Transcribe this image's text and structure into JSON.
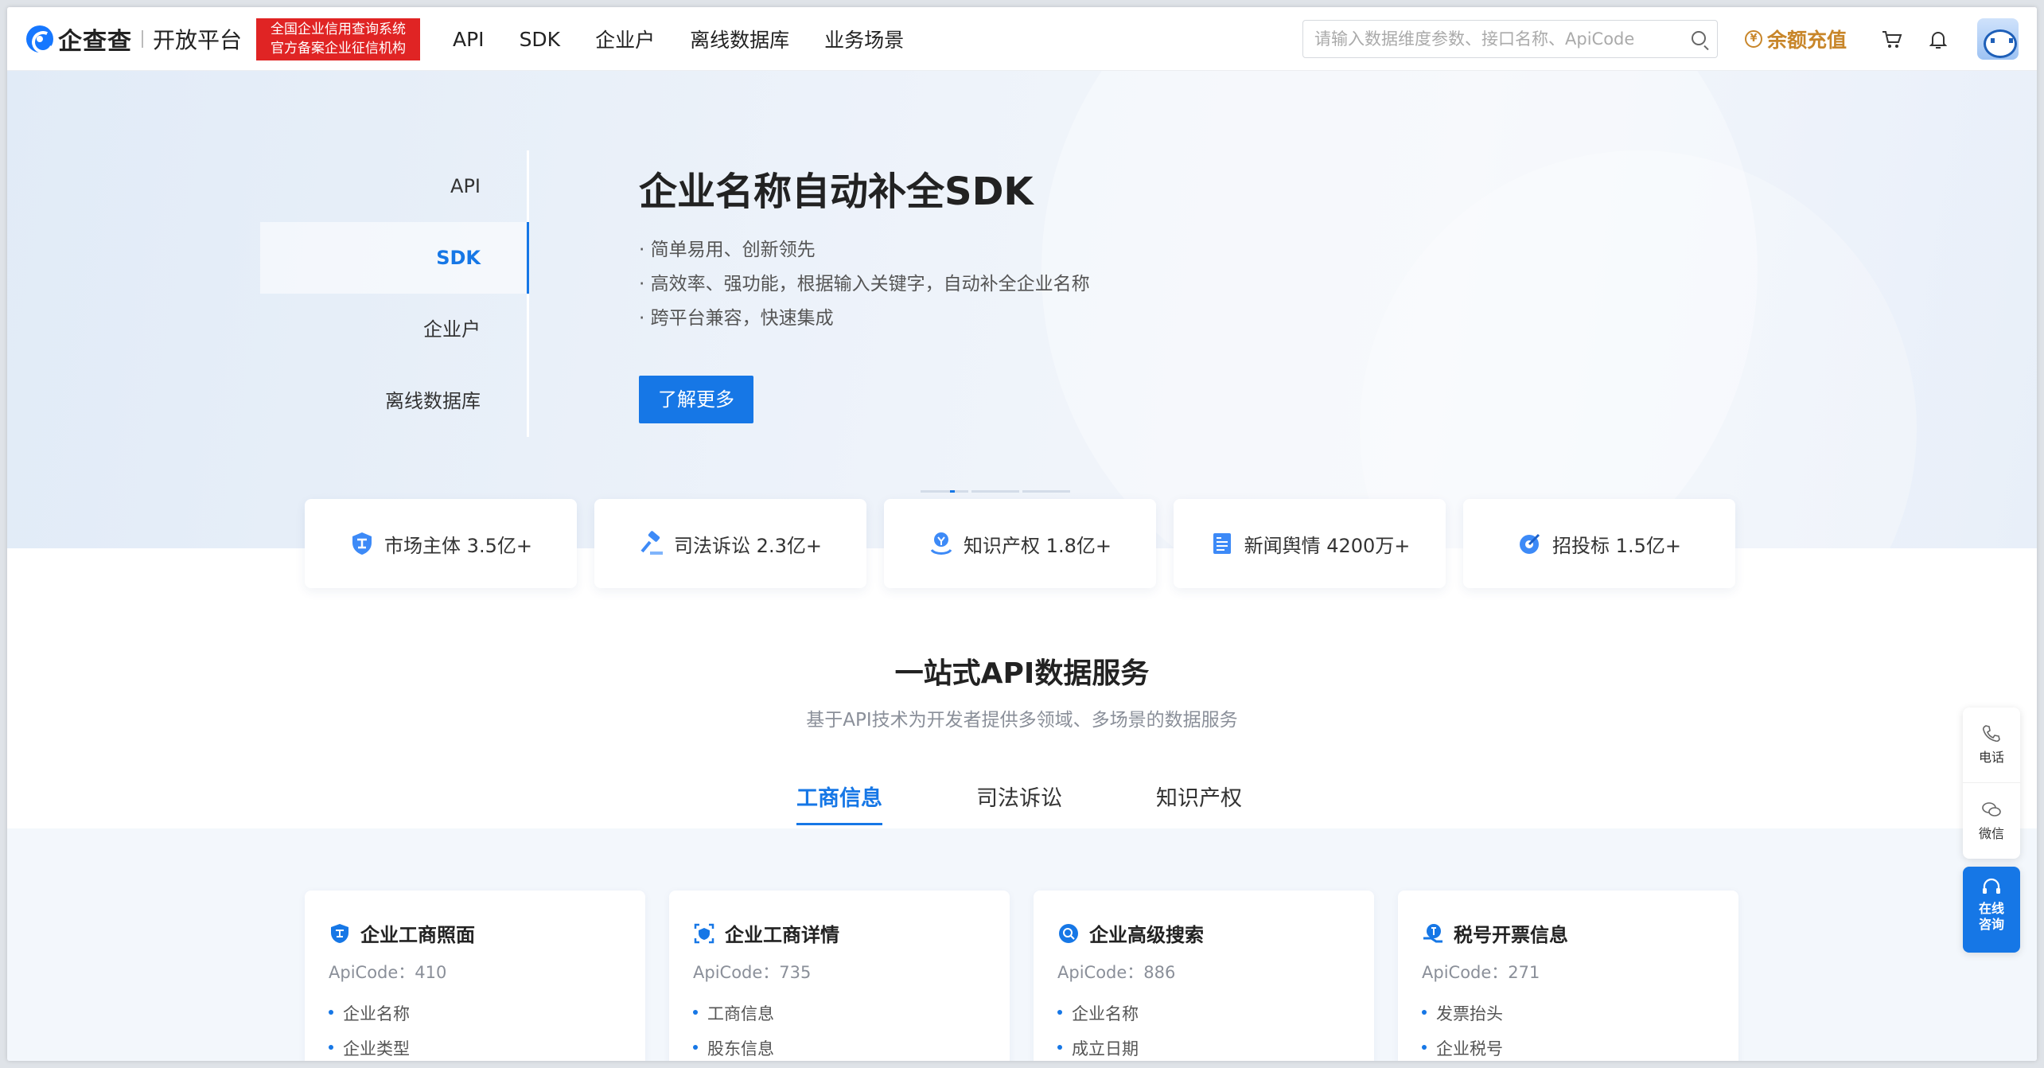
{
  "header": {
    "logo_text": "企查查",
    "logo_sub": "开放平台",
    "badge_line1": "全国企业信用查询系统",
    "badge_line2": "官方备案企业征信机构",
    "nav": [
      "API",
      "SDK",
      "企业户",
      "离线数据库",
      "业务场景"
    ],
    "search_placeholder": "请输入数据维度参数、接口名称、ApiCode",
    "recharge": "余额充值",
    "accent": "#1677e6"
  },
  "hero": {
    "side_tabs": [
      "API",
      "SDK",
      "企业户",
      "离线数据库"
    ],
    "active_tab": "SDK",
    "title": "企业名称自动补全SDK",
    "points": [
      "· 简单易用、创新领先",
      "· 高效率、强功能，根据输入关键字，自动补全企业名称",
      "· 跨平台兼容，快速集成"
    ],
    "button": "了解更多"
  },
  "stats": [
    {
      "icon": "shield-icon",
      "label": "市场主体 3.5亿+"
    },
    {
      "icon": "gavel-icon",
      "label": "司法诉讼 2.3亿+"
    },
    {
      "icon": "ip-icon",
      "label": "知识产权 1.8亿+"
    },
    {
      "icon": "news-icon",
      "label": "新闻舆情 4200万+"
    },
    {
      "icon": "bid-icon",
      "label": "招投标 1.5亿+"
    }
  ],
  "section": {
    "title": "一站式API数据服务",
    "subtitle": "基于API技术为开发者提供多领域、多场景的数据服务",
    "tabs": [
      "工商信息",
      "司法诉讼",
      "知识产权"
    ]
  },
  "cards": [
    {
      "title": "企业工商照面",
      "code": "ApiCode：410",
      "items": [
        "企业名称",
        "企业类型"
      ]
    },
    {
      "title": "企业工商详情",
      "code": "ApiCode：735",
      "items": [
        "工商信息",
        "股东信息"
      ]
    },
    {
      "title": "企业高级搜索",
      "code": "ApiCode：886",
      "items": [
        "企业名称",
        "成立日期"
      ]
    },
    {
      "title": "税号开票信息",
      "code": "ApiCode：271",
      "items": [
        "发票抬头",
        "企业税号"
      ]
    }
  ],
  "float": {
    "phone": "电话",
    "wechat": "微信",
    "online_1": "在线",
    "online_2": "咨询"
  }
}
